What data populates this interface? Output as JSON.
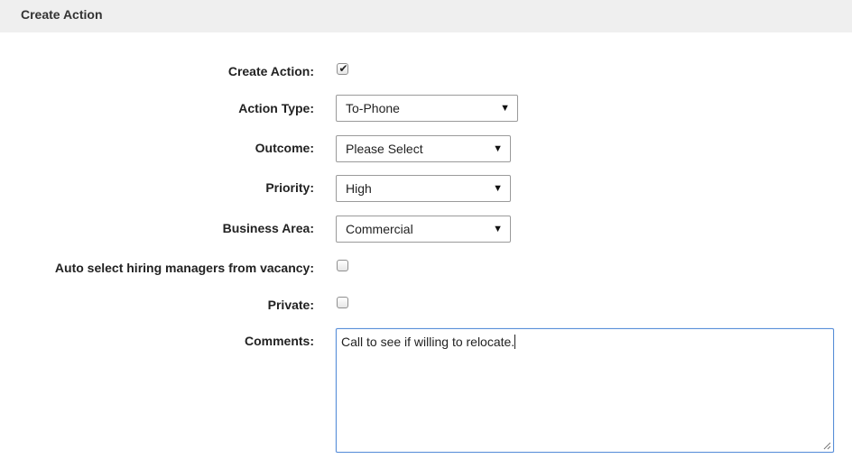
{
  "header": {
    "title": "Create Action"
  },
  "form": {
    "create_action": {
      "label": "Create Action:",
      "checked": true
    },
    "action_type": {
      "label": "Action Type:",
      "value": "To-Phone"
    },
    "outcome": {
      "label": "Outcome:",
      "value": "Please Select"
    },
    "priority": {
      "label": "Priority:",
      "value": "High"
    },
    "business_area": {
      "label": "Business Area:",
      "value": "Commercial"
    },
    "auto_select": {
      "label": "Auto select hiring managers from vacancy:",
      "checked": false
    },
    "private": {
      "label": "Private:",
      "checked": false
    },
    "comments": {
      "label": "Comments:",
      "value": "Call to see if willing to relocate."
    }
  },
  "icons": {
    "checkmark": "✔",
    "dropdown_arrow": "▼"
  },
  "colors": {
    "header_bg": "#efefef",
    "focus_border": "#5a8fd8"
  }
}
